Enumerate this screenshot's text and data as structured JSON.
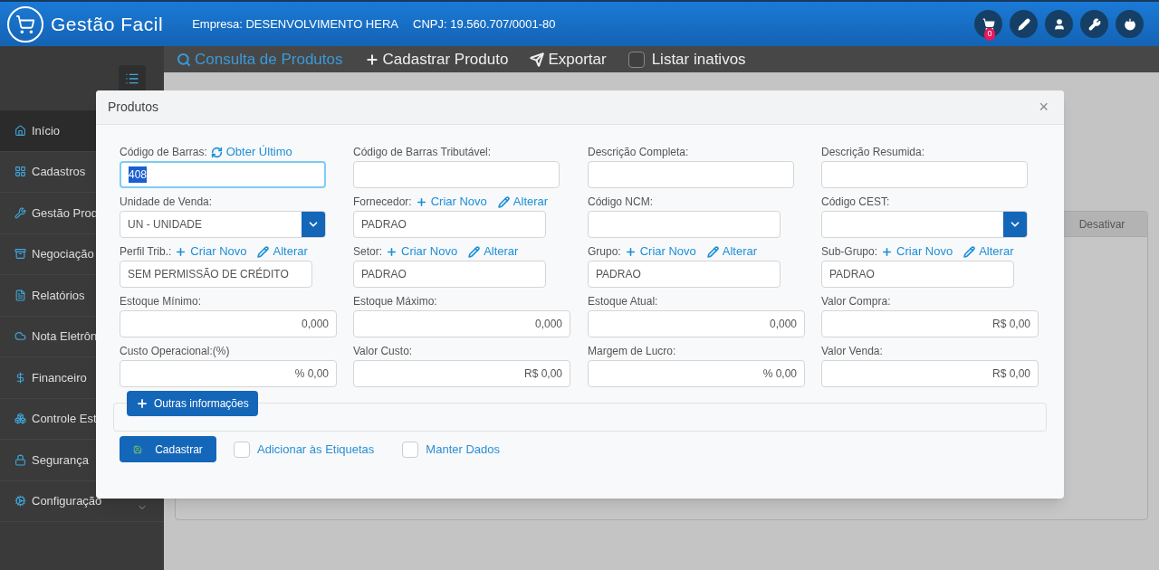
{
  "header": {
    "brand": "Gestão Facil",
    "company": "Empresa: DESENVOLVIMENTO HERA",
    "cnpj": "CNPJ: 19.560.707/0001-80",
    "cart_count": "0"
  },
  "sidebar": {
    "items": [
      {
        "label": "Início",
        "selected": true
      },
      {
        "label": "Cadastros",
        "selected": false
      },
      {
        "label": "Gestão Prod",
        "selected": false
      },
      {
        "label": "Negociação",
        "selected": false
      },
      {
        "label": "Relatórios",
        "selected": false
      },
      {
        "label": "Nota Eletrôn",
        "selected": false
      },
      {
        "label": "Financeiro",
        "selected": false
      },
      {
        "label": "Controle Est",
        "selected": false
      },
      {
        "label": "Segurança",
        "selected": false
      },
      {
        "label": "Configuração",
        "selected": false,
        "expandable": true
      }
    ]
  },
  "toolbar": {
    "items": [
      {
        "label": "Consulta de Produtos",
        "selected": true
      },
      {
        "label": "Cadastrar Produto",
        "selected": false
      },
      {
        "label": "Exportar",
        "selected": false
      }
    ],
    "checkbox": {
      "label": "Listar inativos",
      "checked": false
    }
  },
  "background_table": {
    "column": "Desativar"
  },
  "modal": {
    "title": "Produtos",
    "close": "×",
    "rows": [
      [
        {
          "label": "Código de Barras:",
          "kind": "text",
          "value": "408",
          "focused": true,
          "actions": [
            {
              "kind": "refresh",
              "text": "Obter Último"
            }
          ]
        },
        {
          "label": "Código de Barras Tributável:",
          "kind": "text",
          "focused": false
        },
        {
          "label": "Descrição Completa:",
          "kind": "text",
          "focused": false
        },
        {
          "label": "Descrição Resumida:",
          "kind": "text",
          "focused": false
        }
      ],
      [
        {
          "label": "Unidade de Venda:",
          "kind": "select",
          "value": "UN - UNIDADE",
          "focused": false
        },
        {
          "label": "Fornecedor:",
          "kind": "text",
          "value": "PADRAO",
          "focused": false,
          "actions": [
            {
              "kind": "create",
              "text": "Criar Novo"
            },
            {
              "kind": "edit",
              "text": "Alterar"
            }
          ]
        },
        {
          "label": "Código NCM:",
          "kind": "text",
          "focused": false
        },
        {
          "label": "Código CEST:",
          "kind": "select",
          "focused": false
        }
      ],
      [
        {
          "label": "Perfil Trib.:",
          "kind": "text",
          "value": "SEM PERMISSÃO DE CRÉDITO",
          "focused": false,
          "actions": [
            {
              "kind": "create",
              "text": "Criar Novo"
            },
            {
              "kind": "edit",
              "text": "Alterar"
            }
          ]
        },
        {
          "label": "Setor:",
          "kind": "text",
          "value": "PADRAO",
          "focused": false,
          "actions": [
            {
              "kind": "create",
              "text": "Criar Novo"
            },
            {
              "kind": "edit",
              "text": "Alterar"
            }
          ]
        },
        {
          "label": "Grupo:",
          "kind": "text",
          "value": "PADRAO",
          "focused": false,
          "actions": [
            {
              "kind": "create",
              "text": "Criar Novo"
            },
            {
              "kind": "edit",
              "text": "Alterar"
            }
          ]
        },
        {
          "label": "Sub-Grupo:",
          "kind": "text",
          "value": "PADRAO",
          "focused": false,
          "actions": [
            {
              "kind": "create",
              "text": "Criar Novo"
            },
            {
              "kind": "edit",
              "text": "Alterar"
            }
          ]
        }
      ],
      [
        {
          "label": "Estoque Mínimo:",
          "kind": "number",
          "value": "0,000",
          "focused": false
        },
        {
          "label": "Estoque Máximo:",
          "kind": "number",
          "value": "0,000",
          "focused": false
        },
        {
          "label": "Estoque Atual:",
          "kind": "number",
          "value": "0,000",
          "focused": false
        },
        {
          "label": "Valor Compra:",
          "kind": "number",
          "value": "R$ 0,00",
          "focused": false
        }
      ],
      [
        {
          "label": "Custo Operacional:(%)",
          "kind": "number",
          "value": "% 0,00",
          "focused": false
        },
        {
          "label": "Valor Custo:",
          "kind": "number",
          "value": "R$ 0,00",
          "focused": false
        },
        {
          "label": "Margem de Lucro:",
          "kind": "number",
          "value": "% 0,00",
          "focused": false
        },
        {
          "label": "Valor Venda:",
          "kind": "number",
          "value": "R$ 0,00",
          "focused": false
        }
      ]
    ],
    "more_button": "Outras informações",
    "submit": "Cadastrar",
    "checkboxes": [
      {
        "label": "Adicionar às Etiquetas",
        "checked": false
      },
      {
        "label": "Manter Dados",
        "checked": false
      }
    ]
  }
}
